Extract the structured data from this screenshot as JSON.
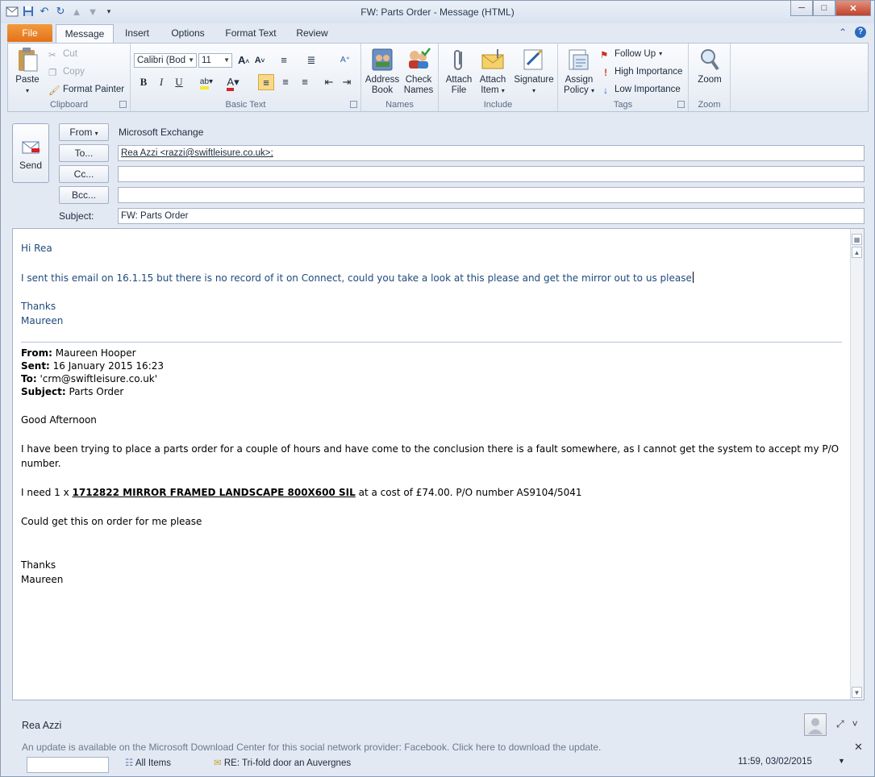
{
  "window": {
    "title": "FW: Parts Order  -  Message (HTML)",
    "min": "─",
    "max": "□",
    "close": "✕"
  },
  "tabs": [
    "File",
    "Message",
    "Insert",
    "Options",
    "Format Text",
    "Review"
  ],
  "ribbon": {
    "clipboard": {
      "paste": "Paste",
      "cut": "Cut",
      "copy": "Copy",
      "format_painter": "Format Painter",
      "label": "Clipboard"
    },
    "basic_text": {
      "font": "Calibri (Bod",
      "size": "11",
      "label": "Basic Text"
    },
    "names": {
      "address_book": [
        "Address",
        "Book"
      ],
      "check_names": [
        "Check",
        "Names"
      ],
      "label": "Names"
    },
    "include": {
      "attach_file": [
        "Attach",
        "File"
      ],
      "attach_item": [
        "Attach",
        "Item"
      ],
      "signature": "Signature",
      "label": "Include"
    },
    "tags": {
      "assign_policy": [
        "Assign",
        "Policy"
      ],
      "follow_up": "Follow Up",
      "high_importance": "High Importance",
      "low_importance": "Low Importance",
      "label": "Tags"
    },
    "zoom": {
      "zoom": "Zoom",
      "label": "Zoom"
    }
  },
  "header": {
    "send": "Send",
    "from_btn": "From",
    "from_value": "Microsoft Exchange",
    "to_btn": "To...",
    "to_value": "Rea Azzi <razzi@swiftleisure.co.uk>;",
    "cc_btn": "Cc...",
    "cc_value": "",
    "bcc_btn": "Bcc...",
    "bcc_value": "",
    "subject_label": "Subject:",
    "subject_value": "FW: Parts Order"
  },
  "body": {
    "greeting": "Hi Rea",
    "line1": "I sent this email on 16.1.15 but there is no record of it on Connect, could you take a look at this please and get the mirror out to us please",
    "thanks": "Thanks",
    "sig": "Maureen",
    "orig": {
      "from_label": "From:",
      "from": " Maureen Hooper",
      "sent_label": "Sent:",
      "sent": " 16 January 2015 16:23",
      "to_label": "To:",
      "to": " 'crm@swiftleisure.co.uk'",
      "subject_label": "Subject:",
      "subject": " Parts Order",
      "greeting": "Good Afternoon",
      "para1a": "I have been trying to place a parts order for a couple of hours and have come to the conclusion there is a fault somewhere, as I cannot get the system to accept my P/O",
      "para1b": "number.",
      "need_pre": "I need 1 x ",
      "need_item": "1712822 MIRROR FRAMED LANDSCAPE 800X600 SIL",
      "need_post": " at a cost of £74.00.  P/O number AS9104/5041",
      "request": "Could get this on order for me please",
      "thanks": "Thanks",
      "sig": "Maureen"
    }
  },
  "people_pane": {
    "name": "Rea Azzi",
    "update": "An update is available on the Microsoft Download Center for this social network provider: Facebook. Click here to download the update.",
    "feed_all": "All Items",
    "feed_item": "RE: Tri-fold door an Auvergnes",
    "feed_time": "11:59, 03/02/2015"
  },
  "colors": {
    "file_tab": "#e2731b",
    "body_blue": "#1f497d",
    "title_bg": "#dfe6f0"
  }
}
